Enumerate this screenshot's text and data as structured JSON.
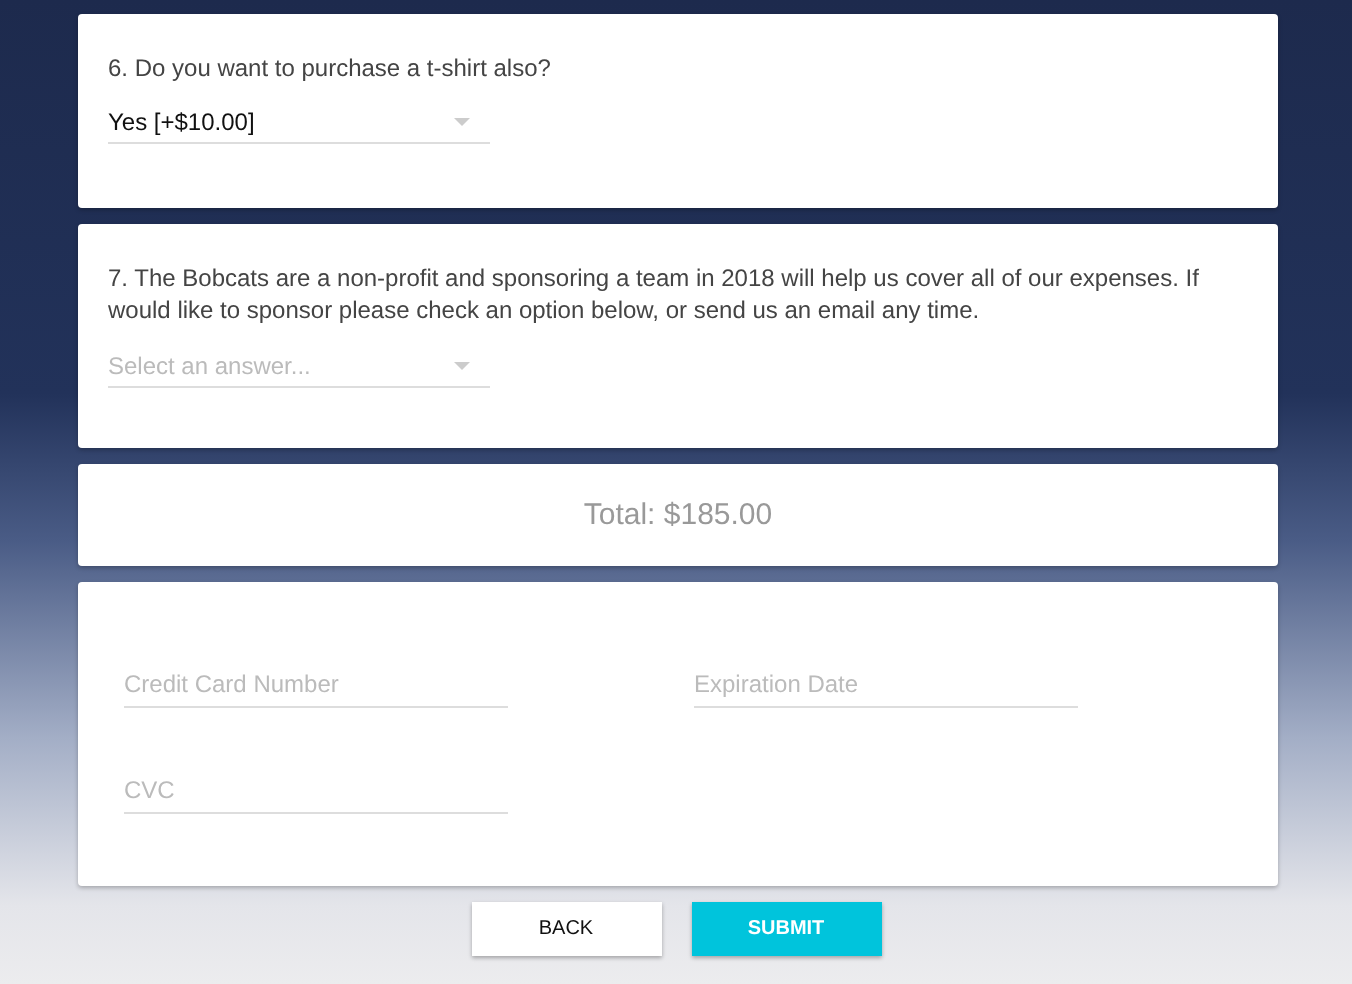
{
  "questions": [
    {
      "label": "6. Do you want to purchase a t-shirt also?",
      "value": "Yes [+$10.00]"
    },
    {
      "label": "7. The Bobcats are a non-profit and sponsoring a team in 2018 will help us cover all of our expenses. If would like to sponsor please check an option below, or send us an email any time.",
      "placeholder": "Select an answer..."
    }
  ],
  "total": "Total: $185.00",
  "payment_fields": [
    {
      "placeholder": "Credit Card Number"
    },
    {
      "placeholder": "Expiration Date"
    },
    {
      "placeholder": "CVC"
    }
  ],
  "buttons": [
    {
      "label": "BACK",
      "kind": "secondary"
    },
    {
      "label": "SUBMIT",
      "kind": "primary"
    }
  ]
}
